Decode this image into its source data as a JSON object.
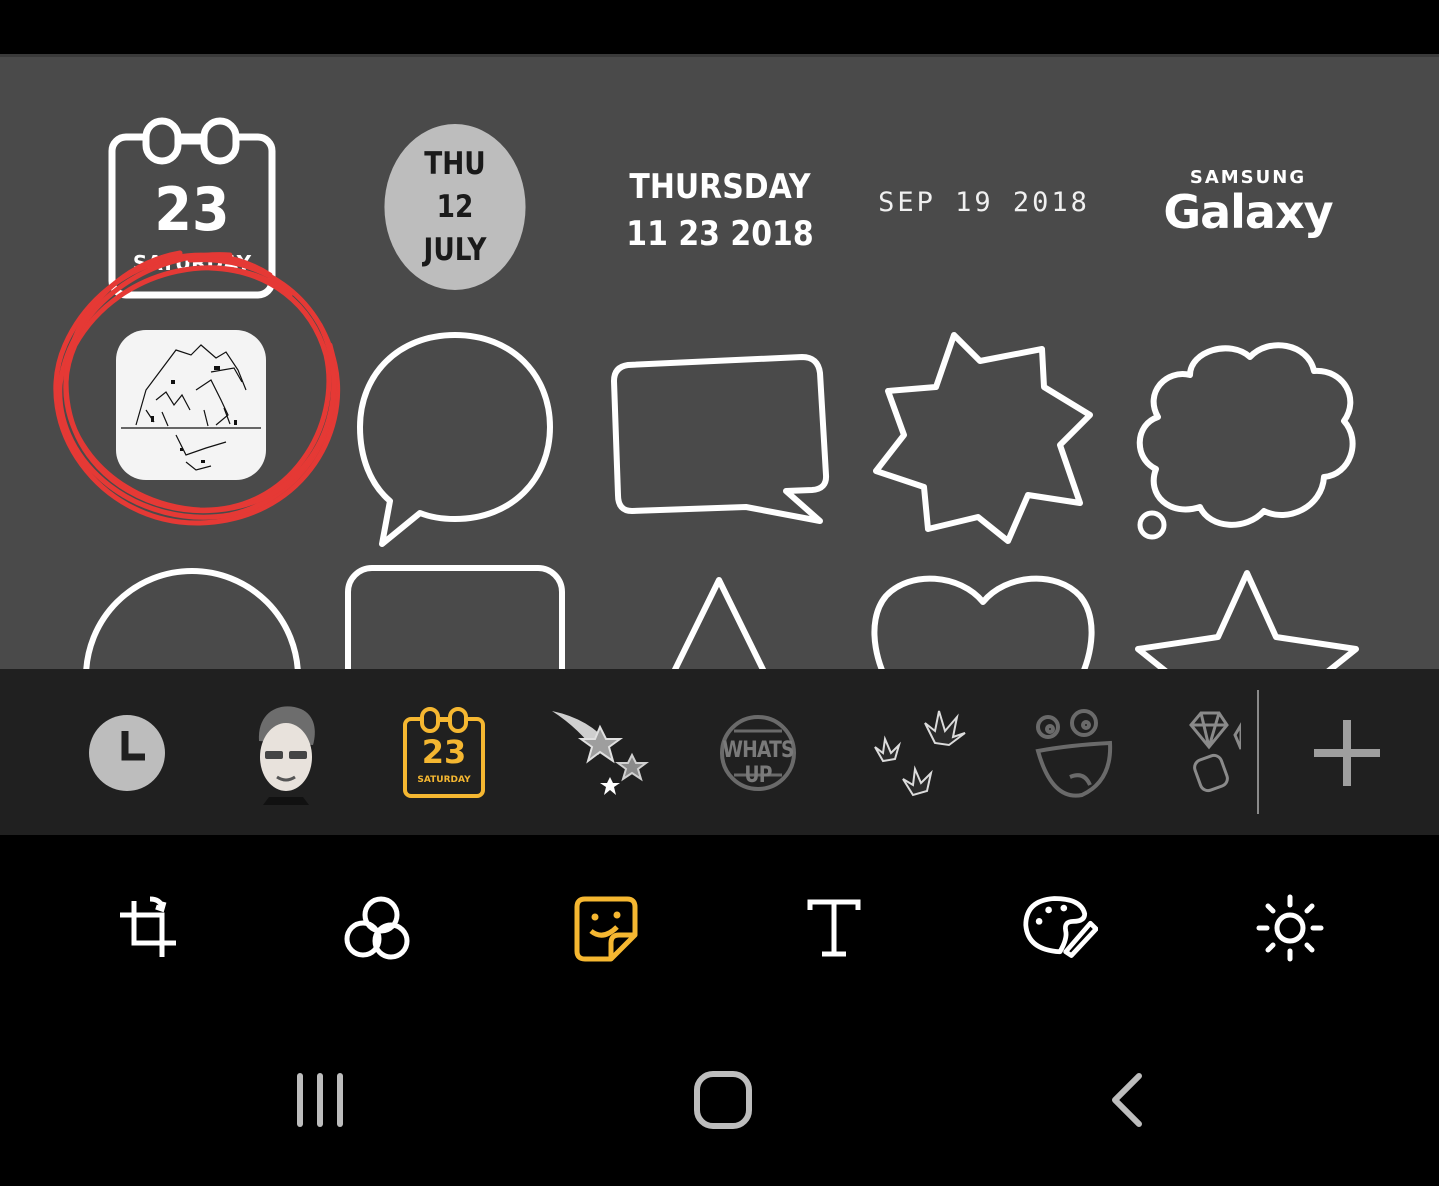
{
  "stickers": {
    "calendar": {
      "day": "23",
      "weekday": "SATURDAY"
    },
    "circle_date": {
      "line1": "THU",
      "line2": "12",
      "line3": "JULY"
    },
    "date_bold": {
      "line1": "THURSDAY",
      "line2": "11 23 2018"
    },
    "date_mono": "SEP 19 2018",
    "samsung": {
      "brand": "SAMSUNG",
      "product": "Galaxy"
    }
  },
  "categories": [
    {
      "name": "clock",
      "icon": "clock-icon"
    },
    {
      "name": "avatar",
      "icon": "avatar-icon"
    },
    {
      "name": "calendar",
      "icon": "calendar-icon",
      "day": "23",
      "weekday": "SATURDAY",
      "selected": true
    },
    {
      "name": "stars",
      "icon": "shooting-stars-icon"
    },
    {
      "name": "whats-up",
      "icon": "whats-up-badge-icon",
      "label": "WHATS UP"
    },
    {
      "name": "flowers",
      "icon": "flowers-icon"
    },
    {
      "name": "faces",
      "icon": "face-doodle-icon"
    },
    {
      "name": "gems",
      "icon": "gems-icon"
    }
  ],
  "toolbar": [
    {
      "name": "transform",
      "icon": "crop-rotate-icon"
    },
    {
      "name": "filters",
      "icon": "filters-icon"
    },
    {
      "name": "stickers",
      "icon": "sticker-icon",
      "selected": true
    },
    {
      "name": "text",
      "icon": "text-icon"
    },
    {
      "name": "draw",
      "icon": "palette-brush-icon"
    },
    {
      "name": "adjust",
      "icon": "brightness-icon"
    }
  ],
  "navigation": [
    "recent-apps-icon",
    "home-icon",
    "back-icon"
  ],
  "colors": {
    "accent": "#f5b731",
    "panel": "#4a4a4a",
    "category_bar": "#202020",
    "annotation": "#e53935"
  }
}
